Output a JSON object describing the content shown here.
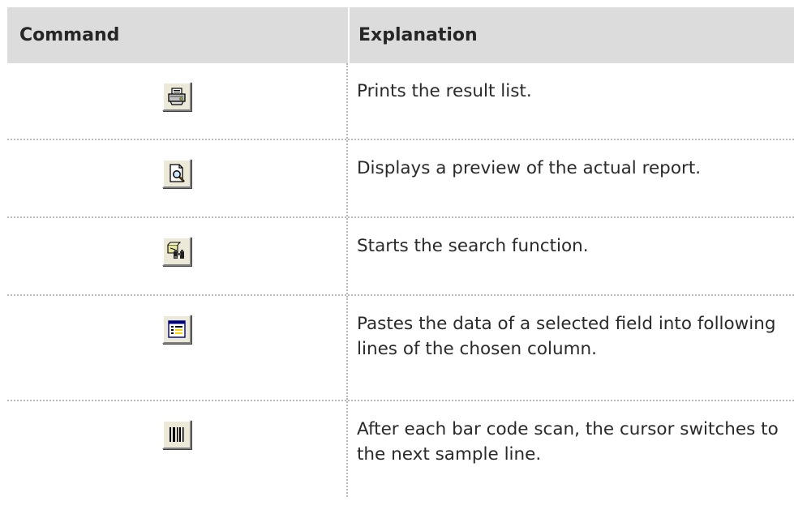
{
  "header": {
    "command": "Command",
    "explanation": "Explanation"
  },
  "rows": [
    {
      "icon": "printer-icon",
      "explanation": "Prints the result list."
    },
    {
      "icon": "print-preview-icon",
      "explanation": "Displays a preview of the actual report."
    },
    {
      "icon": "search-binoculars-icon",
      "explanation": "Starts the search function."
    },
    {
      "icon": "paste-column-icon",
      "explanation": "Pastes the data of a selected field into following lines of the chosen column."
    },
    {
      "icon": "barcode-icon",
      "explanation": "After each bar code scan, the cursor switches to the next sample line."
    }
  ]
}
